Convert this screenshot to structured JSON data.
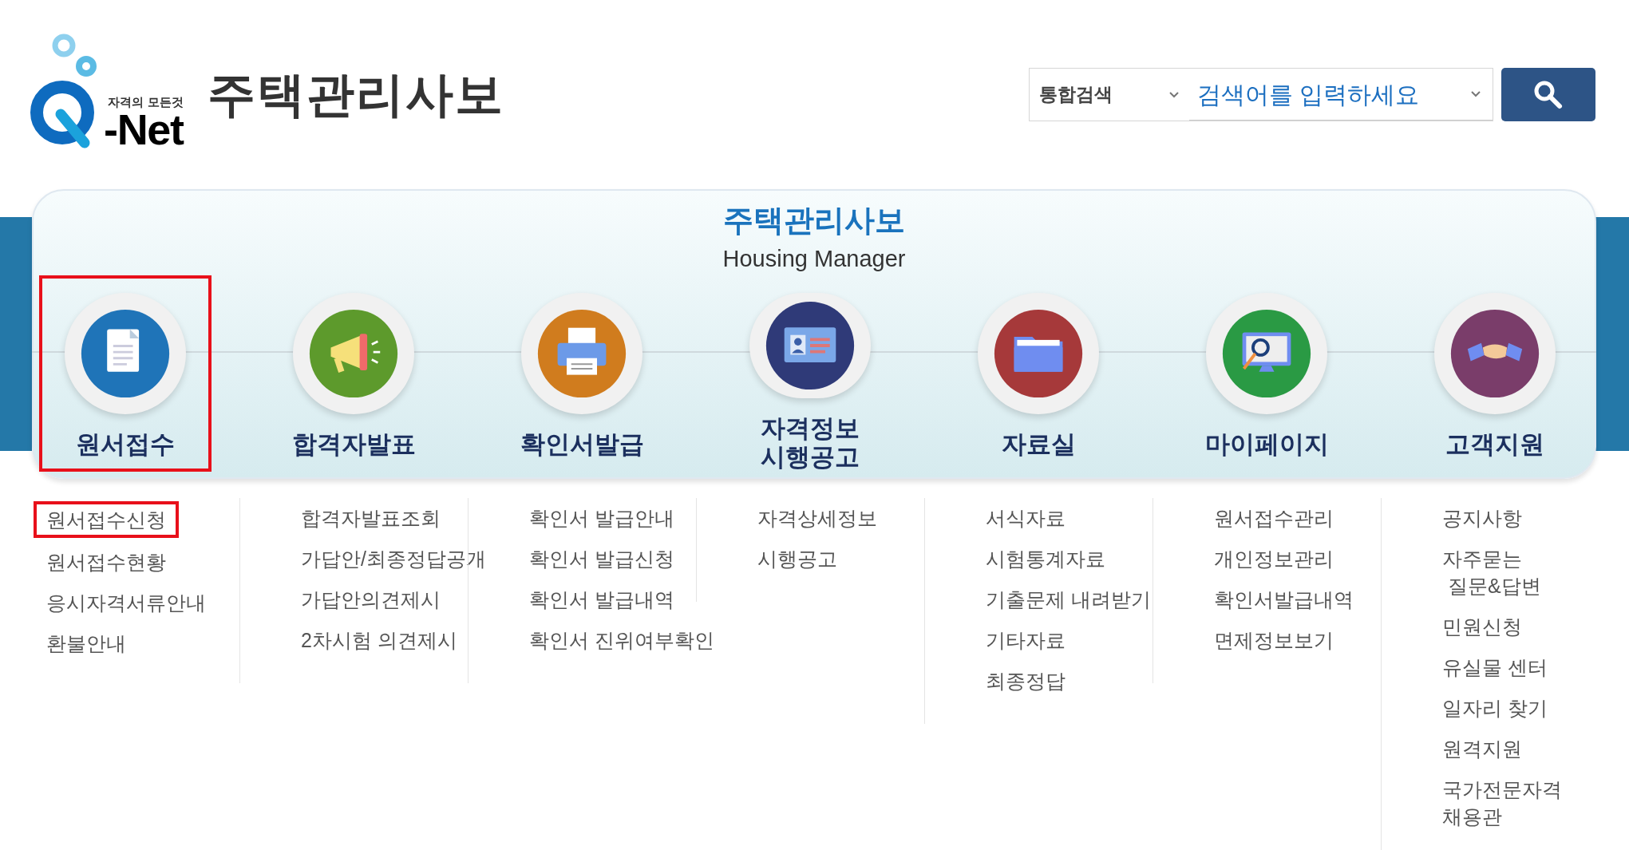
{
  "logo": {
    "tagline": "자격의 모든것",
    "name": "-Net"
  },
  "site_title": "주택관리사보",
  "search": {
    "scope": "통합검색",
    "placeholder": "검색어를 입력하세요"
  },
  "panel": {
    "title": "주택관리사보",
    "subtitle": "Housing Manager"
  },
  "menu": [
    {
      "label": "원서접수",
      "selected": true,
      "items": [
        {
          "label": "원서접수신청",
          "selected": true
        },
        {
          "label": "원서접수현황",
          "selected": false
        },
        {
          "label": "응시자격서류안내",
          "selected": false
        },
        {
          "label": "환불안내",
          "selected": false
        }
      ]
    },
    {
      "label": "합격자발표",
      "selected": false,
      "items": [
        {
          "label": "합격자발표조회",
          "selected": false
        },
        {
          "label": "가답안/최종정답공개",
          "selected": false
        },
        {
          "label": "가답안의견제시",
          "selected": false
        },
        {
          "label": "2차시험 의견제시",
          "selected": false
        }
      ]
    },
    {
      "label": "확인서발급",
      "selected": false,
      "items": [
        {
          "label": "확인서 발급안내",
          "selected": false
        },
        {
          "label": "확인서 발급신청",
          "selected": false
        },
        {
          "label": "확인서 발급내역",
          "selected": false
        },
        {
          "label": "확인서 진위여부확인",
          "selected": false
        }
      ]
    },
    {
      "label": "자격정보\n시행공고",
      "selected": false,
      "items": [
        {
          "label": "자격상세정보",
          "selected": false
        },
        {
          "label": "시행공고",
          "selected": false
        }
      ]
    },
    {
      "label": "자료실",
      "selected": false,
      "items": [
        {
          "label": "서식자료",
          "selected": false
        },
        {
          "label": "시험통계자료",
          "selected": false
        },
        {
          "label": "기출문제 내려받기",
          "selected": false
        },
        {
          "label": "기타자료",
          "selected": false
        },
        {
          "label": "최종정답",
          "selected": false
        }
      ]
    },
    {
      "label": "마이페이지",
      "selected": false,
      "items": [
        {
          "label": "원서접수관리",
          "selected": false
        },
        {
          "label": "개인정보관리",
          "selected": false
        },
        {
          "label": "확인서발급내역",
          "selected": false
        },
        {
          "label": "면제정보보기",
          "selected": false
        }
      ]
    },
    {
      "label": "고객지원",
      "selected": false,
      "items": [
        {
          "label": "공지사항",
          "selected": false
        },
        {
          "label": "자주묻는\n 질문&답변",
          "selected": false
        },
        {
          "label": "민원신청",
          "selected": false
        },
        {
          "label": "유실물 센터",
          "selected": false
        },
        {
          "label": "일자리 찾기",
          "selected": false
        },
        {
          "label": "원격지원",
          "selected": false
        },
        {
          "label": "국가전문자격\n채용관",
          "selected": false
        }
      ]
    }
  ]
}
